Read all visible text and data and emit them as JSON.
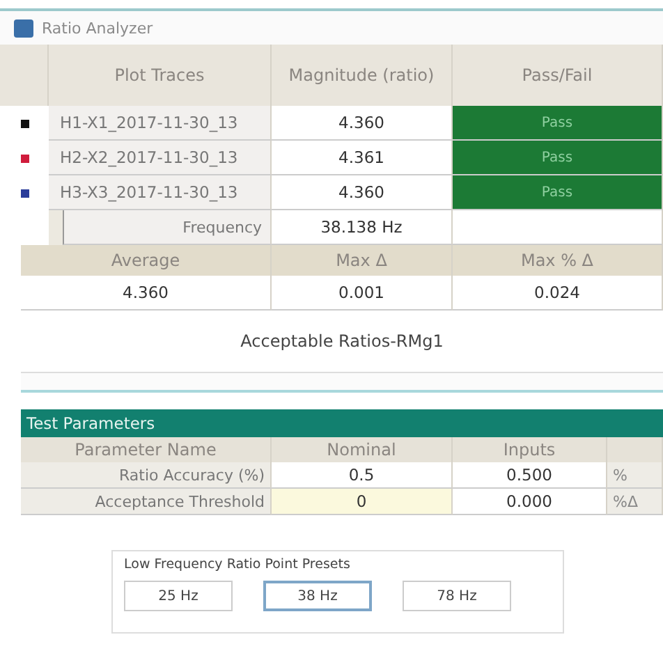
{
  "window": {
    "title": "Ratio Analyzer"
  },
  "traces": {
    "columns": [
      "Plot Traces",
      "Magnitude (ratio)",
      "Pass/Fail"
    ],
    "rows": [
      {
        "color": "#111111",
        "name": "H1-X1_2017-11-30_13",
        "magnitude": "4.360",
        "result": "Pass",
        "passed": true
      },
      {
        "color": "#d01c3c",
        "name": "H2-X2_2017-11-30_13",
        "magnitude": "4.361",
        "result": "Pass",
        "passed": true
      },
      {
        "color": "#2a3c9a",
        "name": "H3-X3_2017-11-30_13",
        "magnitude": "4.360",
        "result": "Pass",
        "passed": true
      }
    ],
    "frequency": {
      "label": "Frequency",
      "value": "38.138 Hz"
    }
  },
  "summary": {
    "columns": [
      "Average",
      "Max Δ",
      "Max % Δ"
    ],
    "values": [
      "4.360",
      "0.001",
      "0.024"
    ]
  },
  "acceptable_label": "Acceptable Ratios-RMg1",
  "test_parameters": {
    "title": "Test Parameters",
    "columns": [
      "Parameter Name",
      "Nominal",
      "Inputs"
    ],
    "rows": [
      {
        "name": "Ratio Accuracy (%)",
        "nominal": "0.5",
        "input": "0.500",
        "unit": "%",
        "highlighted": false
      },
      {
        "name": "Acceptance Threshold",
        "nominal": "0",
        "input": "0.000",
        "unit": "%Δ",
        "highlighted": true
      }
    ]
  },
  "presets": {
    "title": "Low Frequency Ratio Point Presets",
    "buttons": [
      {
        "label": "25 Hz",
        "selected": false
      },
      {
        "label": "38 Hz",
        "selected": true
      },
      {
        "label": "78 Hz",
        "selected": false
      }
    ]
  }
}
